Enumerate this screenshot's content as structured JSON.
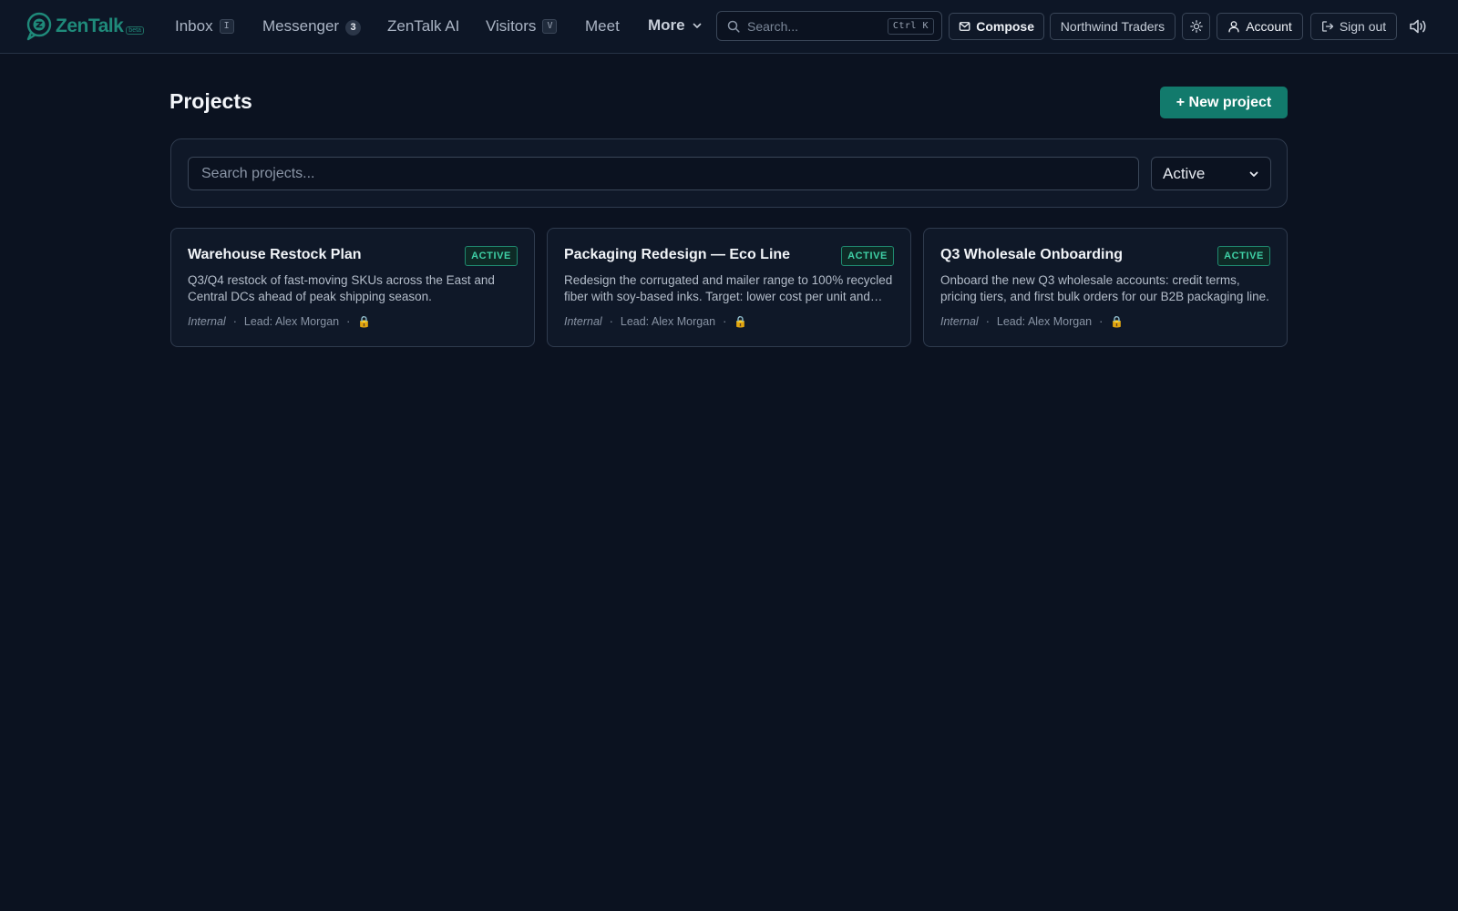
{
  "brand": {
    "name": "ZenTalk",
    "tag": "beta"
  },
  "nav": {
    "inbox": {
      "label": "Inbox",
      "shortcut": "I"
    },
    "messenger": {
      "label": "Messenger",
      "count": "3"
    },
    "ai": {
      "label": "ZenTalk AI"
    },
    "visitors": {
      "label": "Visitors",
      "shortcut": "V"
    },
    "meet": {
      "label": "Meet"
    },
    "more": {
      "label": "More"
    }
  },
  "global_search": {
    "placeholder": "Search...",
    "shortcut": "Ctrl K"
  },
  "header_actions": {
    "compose": "Compose",
    "workspace": "Northwind Traders",
    "account": "Account",
    "sign_out": "Sign out"
  },
  "page": {
    "title": "Projects",
    "new_project": "+ New project"
  },
  "filters": {
    "search_placeholder": "Search projects...",
    "status": "Active"
  },
  "projects": [
    {
      "title": "Warehouse Restock Plan",
      "status": "ACTIVE",
      "description": "Q3/Q4 restock of fast-moving SKUs across the East and Central DCs ahead of peak shipping season.",
      "visibility": "Internal",
      "lead": "Lead: Alex Morgan",
      "separator": "·",
      "lock": "🔒"
    },
    {
      "title": "Packaging Redesign — Eco Line",
      "status": "ACTIVE",
      "description": "Redesign the corrugated and mailer range to 100% recycled fiber with soy-based inks. Target: lower cost per unit and reduced damage in transit.",
      "visibility": "Internal",
      "lead": "Lead: Alex Morgan",
      "separator": "·",
      "lock": "🔒"
    },
    {
      "title": "Q3 Wholesale Onboarding",
      "status": "ACTIVE",
      "description": "Onboard the new Q3 wholesale accounts: credit terms, pricing tiers, and first bulk orders for our B2B packaging line.",
      "visibility": "Internal",
      "lead": "Lead: Alex Morgan",
      "separator": "·",
      "lock": "🔒"
    }
  ],
  "colors": {
    "background": "#0b1220",
    "accent": "#127a6c",
    "badge_text": "#3fd0a6",
    "brand": "#1f8a7a"
  },
  "icons": {
    "logo": "chat-bubble-logo-icon",
    "search": "search-icon",
    "compose": "mail-icon",
    "theme": "sun-icon",
    "account": "user-icon",
    "sign_out": "sign-out-icon",
    "sound": "speaker-icon",
    "lock": "lock-icon",
    "chevron": "chevron-down-icon"
  }
}
